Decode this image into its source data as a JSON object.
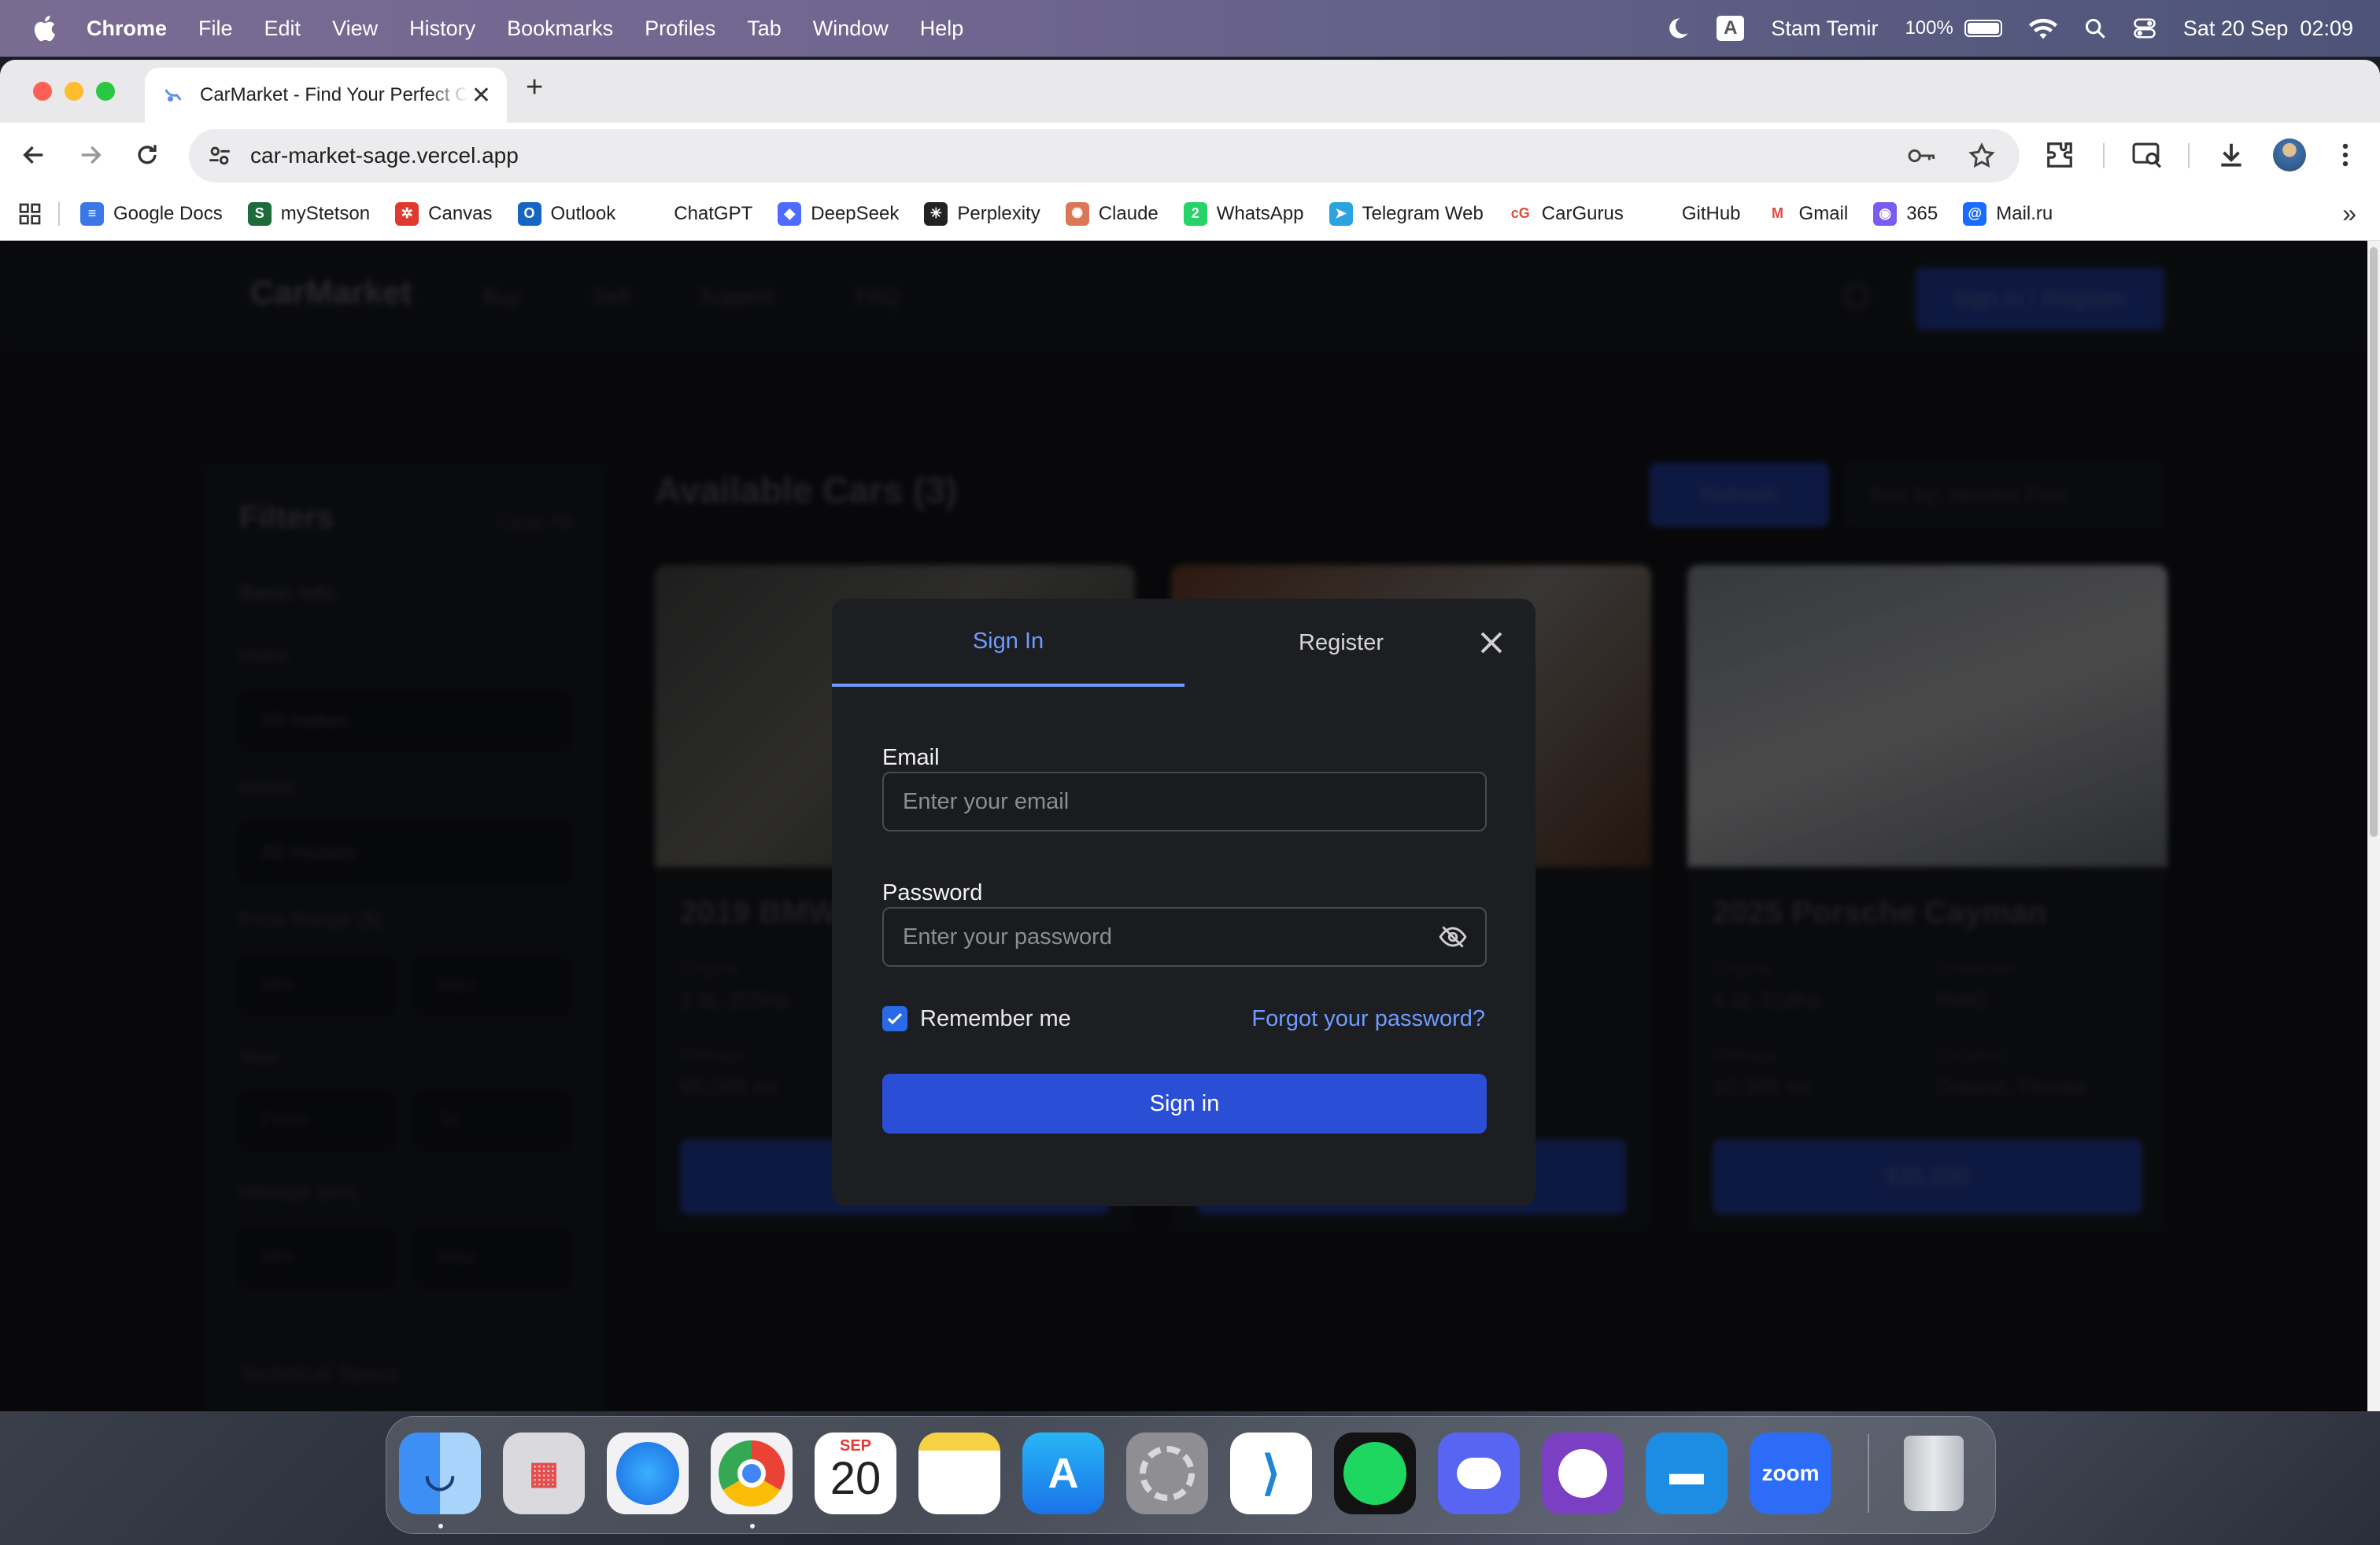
{
  "menubar": {
    "app": "Chrome",
    "items": [
      "File",
      "Edit",
      "View",
      "History",
      "Bookmarks",
      "Profiles",
      "Tab",
      "Window",
      "Help"
    ],
    "input_source": "A",
    "user": "Stam Temir",
    "battery": "100%",
    "datetime": "Sat 20 Sep  02:09"
  },
  "browser": {
    "tab_title": "CarMarket - Find Your Perfect Car",
    "url": "car-market-sage.vercel.app",
    "bookmarks": [
      {
        "label": "Google Docs",
        "color": "#3b78e7",
        "glyph": "≡"
      },
      {
        "label": "myStetson",
        "color": "#1d6b3a",
        "glyph": "S"
      },
      {
        "label": "Canvas",
        "color": "#e03a2f",
        "glyph": "✲"
      },
      {
        "label": "Outlook",
        "color": "#1466c4",
        "glyph": "O"
      },
      {
        "label": "ChatGPT",
        "color": "#ffffff",
        "glyph": ""
      },
      {
        "label": "DeepSeek",
        "color": "#4d6bfe",
        "glyph": "◆"
      },
      {
        "label": "Perplexity",
        "color": "#222222",
        "glyph": "✳"
      },
      {
        "label": "Claude",
        "color": "#d97757",
        "glyph": "✺"
      },
      {
        "label": "WhatsApp",
        "color": "#25d366",
        "glyph": "2"
      },
      {
        "label": "Telegram Web",
        "color": "#2aa3e0",
        "glyph": "➤"
      },
      {
        "label": "CarGurus",
        "color": "#ffffff",
        "glyph": "cG"
      },
      {
        "label": "GitHub",
        "color": "#ffffff",
        "glyph": ""
      },
      {
        "label": "Gmail",
        "color": "#ffffff",
        "glyph": "M"
      },
      {
        "label": "365",
        "color": "#7b5cf0",
        "glyph": "◉"
      },
      {
        "label": "Mail.ru",
        "color": "#1a6cff",
        "glyph": "@"
      }
    ]
  },
  "page": {
    "brand": "CarMarket",
    "nav": [
      "Buy",
      "Sell",
      "Support",
      "FAQ"
    ],
    "header_button": "Sign In / Register",
    "filters_title": "Filters",
    "clear_all": "Clear All",
    "basic_info": "Basic Info",
    "make_label": "Make",
    "make_value": "All makes",
    "model_label": "Model",
    "model_value": "All models",
    "price_label": "Price Range ($)",
    "min": "Min",
    "max": "Max",
    "year_label": "Year",
    "from": "From",
    "to": "To",
    "mileage_label": "Mileage (km)",
    "tech_specs": "Technical Specs",
    "list_title": "Available Cars (3)",
    "refresh": "Refresh",
    "sort": "Sort by: Newest First",
    "cars": [
      {
        "title": "2019 BMW",
        "engine_label": "Engine",
        "engine": "2.0L 255hp",
        "mileage_label": "Mileage",
        "mileage": "65,000 mi",
        "price": ""
      },
      {
        "title": "",
        "engine_label": "",
        "engine": "",
        "mileage_label": "",
        "mileage": "",
        "price": ""
      },
      {
        "title": "2025 Porsche Cayman",
        "engine_label": "Engine",
        "engine": "4.0L 518hp",
        "drivetrain_label": "Drivetrain",
        "drivetrain": "RWD",
        "mileage_label": "Mileage",
        "mileage": "10,300 mi",
        "location_label": "Location",
        "location": "Doland, Florida",
        "price": "$35,000"
      }
    ]
  },
  "modal": {
    "tab_signin": "Sign In",
    "tab_register": "Register",
    "email_label": "Email",
    "email_placeholder": "Enter your email",
    "password_label": "Password",
    "password_placeholder": "Enter your password",
    "remember": "Remember me",
    "remember_checked": true,
    "forgot": "Forgot your password?",
    "submit": "Sign in",
    "accent": "#6e9bff",
    "button_color": "#2a4fd6"
  },
  "dock": {
    "calendar_month": "SEP",
    "calendar_day": "20",
    "zoom": "zoom"
  }
}
